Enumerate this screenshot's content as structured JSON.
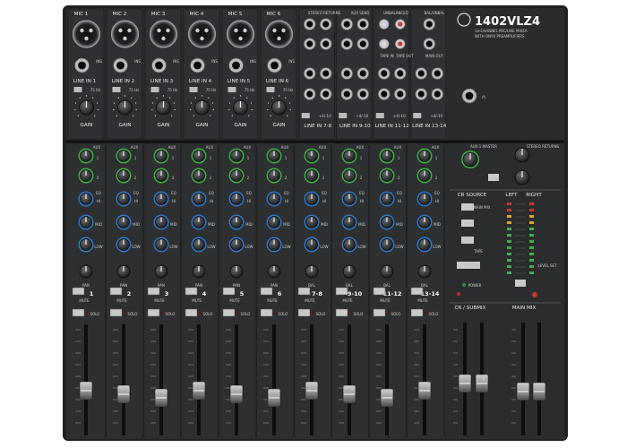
{
  "product": {
    "model": "1402VLZ4",
    "tagline_1": "14-CHANNEL MIC/LINE MIXER",
    "tagline_2": "WITH ONYX PREAMPLIFIERS",
    "brand_colors": {
      "panel": "#2b2c2e",
      "accent_green": "#3fae49",
      "accent_blue": "#2f78c8"
    }
  },
  "mic_labels": [
    "MIC 1",
    "MIC 2",
    "MIC 3",
    "MIC 4",
    "MIC 5",
    "MIC 6"
  ],
  "line_labels": [
    "LINE IN 1",
    "LINE IN 2",
    "LINE IN 3",
    "LINE IN 4",
    "LINE IN 5",
    "LINE IN 6"
  ],
  "gain_label": "GAIN",
  "stereo_in_labels": [
    "LINE IN 7-8",
    "LINE IN 9-10",
    "LINE IN 11-12",
    "LINE IN 13-14"
  ],
  "top_right": {
    "stereo_returns": "STEREO RETURNS",
    "aux_send": "AUX SEND",
    "tape_in": "TAPE IN",
    "tape_out": "TAPE OUT",
    "main_out": "MAIN OUT",
    "unbalanced": "UNBALANCED",
    "balanced": "BAL/UNBAL"
  },
  "strip": {
    "aux": "AUX",
    "eq": "EQ",
    "pan": "PAN",
    "bal": "BAL",
    "mute": "MUTE",
    "solo": "SOLO"
  },
  "channel_numbers": [
    "1",
    "2",
    "3",
    "4",
    "5",
    "6",
    "7-8",
    "9-10",
    "11-12",
    "13-14"
  ],
  "master": {
    "aux1_master": "AUX 1 MASTER",
    "stereo_returns": "STEREO RETURNS",
    "cr_source": "CR SOURCE",
    "main_mix": "MAIN MIX",
    "tape": "TAPE",
    "left": "LEFT",
    "right": "RIGHT",
    "cr_submix": "CR / SUBMIX",
    "main_mix_fader": "MAIN MIX",
    "power": "POWER",
    "level_set": "LEVEL SET",
    "phones": "PHONES"
  }
}
